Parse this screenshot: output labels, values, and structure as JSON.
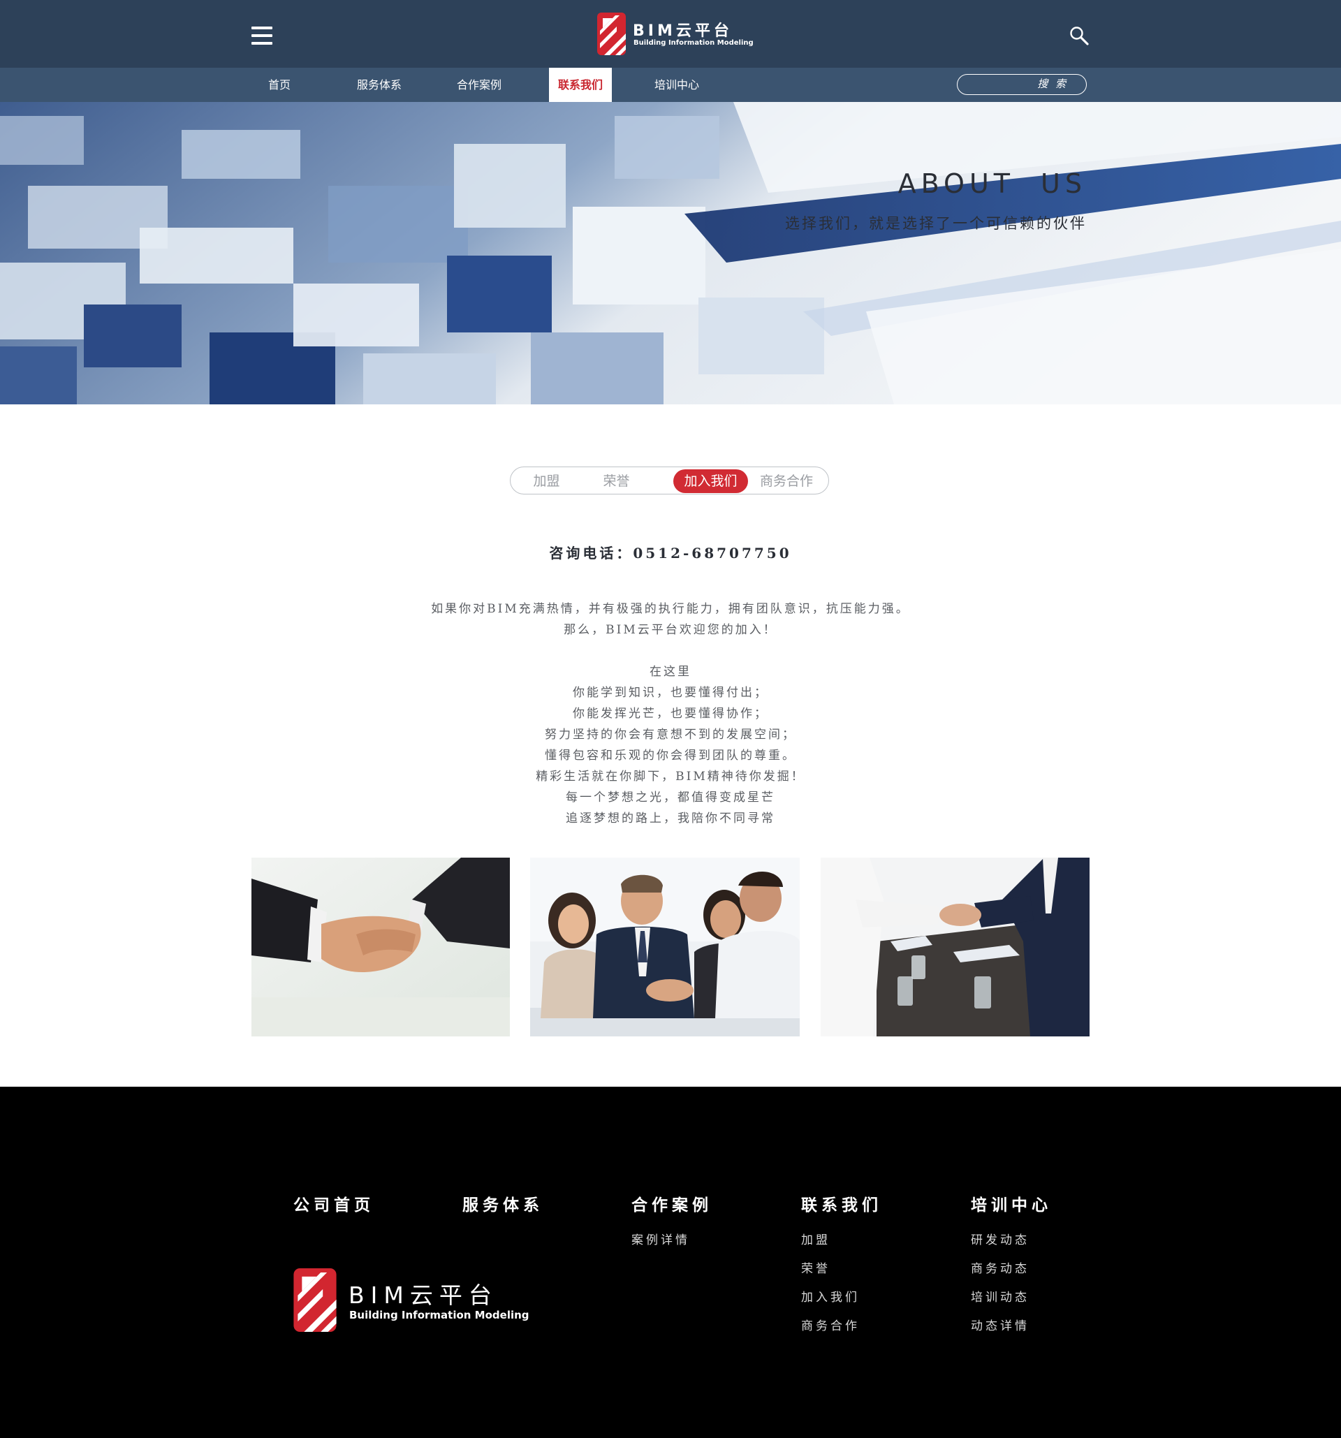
{
  "header": {
    "logo_name": "BIM云平台",
    "logo_sub": "Building Information Modeling"
  },
  "nav": {
    "items": [
      {
        "label": "首页"
      },
      {
        "label": "服务体系"
      },
      {
        "label": "合作案例"
      },
      {
        "label": "联系我们",
        "active": true
      },
      {
        "label": "培训中心"
      }
    ],
    "search_label": "搜 索"
  },
  "hero": {
    "title": "ABOUT US",
    "subtitle": "选择我们，就是选择了一个可信赖的伙伴"
  },
  "tabs": [
    {
      "label": "加盟"
    },
    {
      "label": "荣誉"
    },
    {
      "label": "加入我们",
      "active": true
    },
    {
      "label": "商务合作"
    }
  ],
  "contact": {
    "phone": "咨询电话：0512-68707750"
  },
  "intro": [
    "如果你对BIM充满热情，并有极强的执行能力，拥有团队意识，抗压能力强。",
    "那么，BIM云平台欢迎您的加入！"
  ],
  "poem": [
    "在这里",
    "你能学到知识，也要懂得付出；",
    "你能发挥光芒，也要懂得协作；",
    "努力坚持的你会有意想不到的发展空间；",
    "懂得包容和乐观的你会得到团队的尊重。",
    "精彩生活就在你脚下，BIM精神待你发掘！",
    "每一个梦想之光，都值得变成星芒",
    "追逐梦想的路上，我陪你不同寻常"
  ],
  "footer": {
    "columns": [
      {
        "title": "公司首页",
        "links": []
      },
      {
        "title": "服务体系",
        "links": []
      },
      {
        "title": "合作案例",
        "links": [
          "案例详情"
        ]
      },
      {
        "title": "联系我们",
        "links": [
          "加盟",
          "荣誉",
          "加入我们",
          "商务合作"
        ]
      },
      {
        "title": "培训中心",
        "links": [
          "研发动态",
          "商务动态",
          "培训动态",
          "动态详情"
        ]
      }
    ],
    "logo_name": "BIM云平台",
    "logo_sub": "Building Information Modeling"
  },
  "colors": {
    "header_bg": "#2d4159",
    "nav_bg": "#3b5470",
    "accent_red": "#d12b33",
    "footer_bg": "#000000"
  },
  "icons": {
    "menu": "hamburger-menu-icon",
    "search": "magnifier-icon"
  }
}
